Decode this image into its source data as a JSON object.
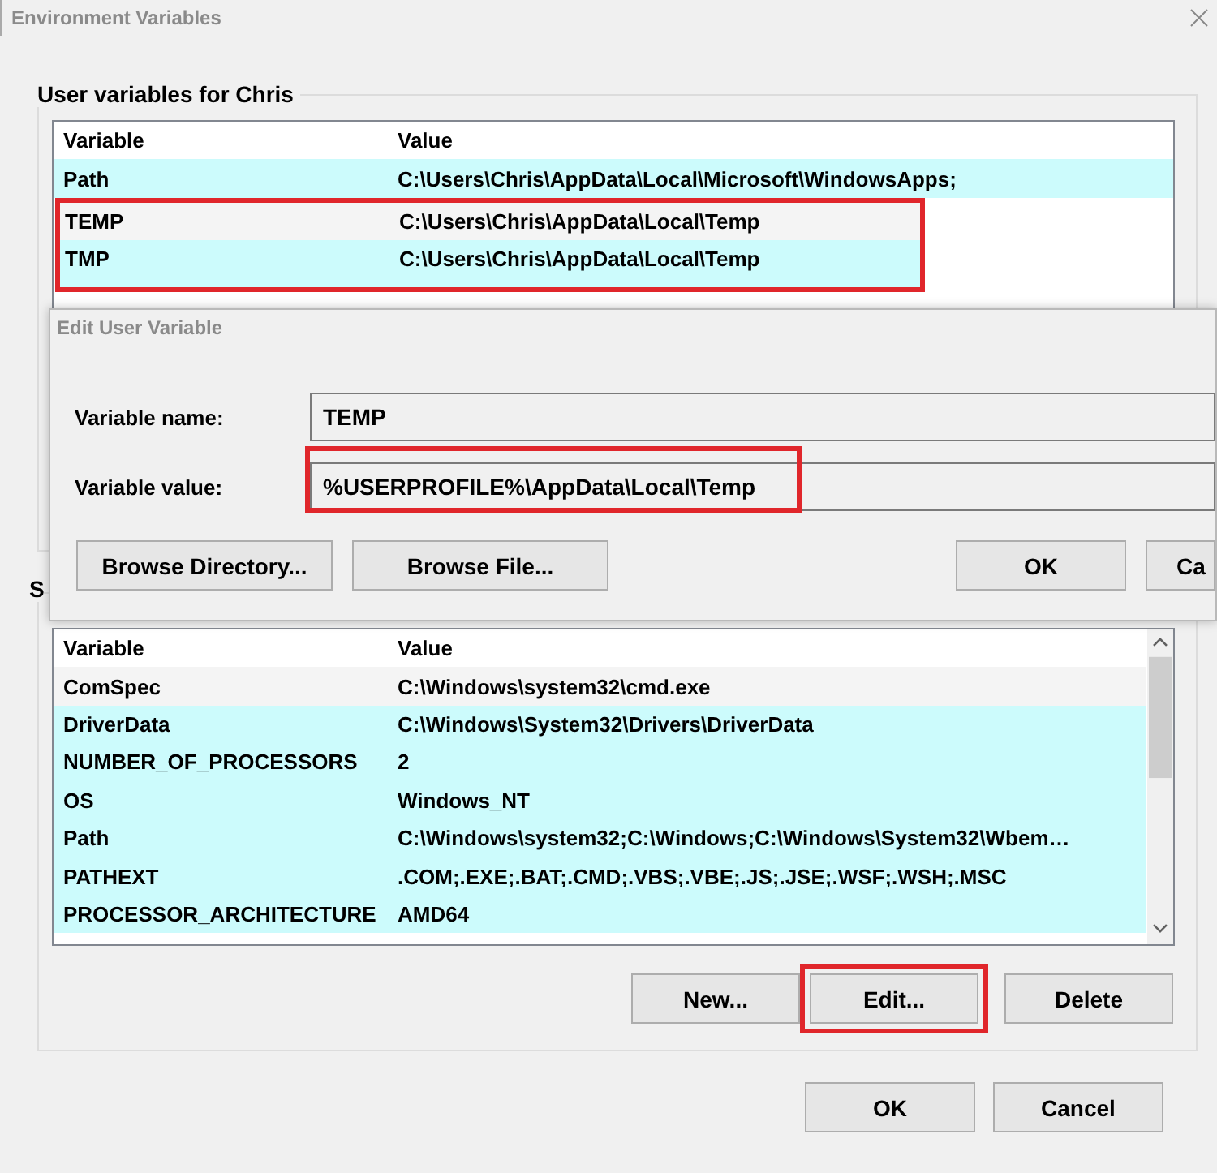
{
  "window": {
    "title": "Environment Variables"
  },
  "user_variables": {
    "label": "User variables for Chris",
    "columns": [
      "Variable",
      "Value"
    ],
    "rows": [
      {
        "variable": "Path",
        "value": "C:\\Users\\Chris\\AppData\\Local\\Microsoft\\WindowsApps;",
        "selected": false,
        "highlighted": false
      },
      {
        "variable": "TEMP",
        "value": "C:\\Users\\Chris\\AppData\\Local\\Temp",
        "selected": true,
        "highlighted": true
      },
      {
        "variable": "TMP",
        "value": "C:\\Users\\Chris\\AppData\\Local\\Temp",
        "selected": false,
        "highlighted": true
      }
    ]
  },
  "edit_dialog": {
    "title": "Edit User Variable",
    "fields": [
      {
        "label": "Variable name:",
        "value": "TEMP",
        "highlighted": false
      },
      {
        "label": "Variable value:",
        "value": "%USERPROFILE%\\AppData\\Local\\Temp",
        "highlighted": true
      }
    ],
    "buttons": [
      {
        "label": "Browse Directory...",
        "kind": "left"
      },
      {
        "label": "Browse File...",
        "kind": "left"
      },
      {
        "label": "OK",
        "kind": "right"
      },
      {
        "label": "Ca",
        "kind": "right"
      }
    ]
  },
  "system_variables": {
    "label": "S",
    "columns": [
      "Variable",
      "Value"
    ],
    "rows": [
      {
        "variable": "ComSpec",
        "value": "C:\\Windows\\system32\\cmd.exe",
        "selected": true
      },
      {
        "variable": "DriverData",
        "value": "C:\\Windows\\System32\\Drivers\\DriverData",
        "selected": false
      },
      {
        "variable": "NUMBER_OF_PROCESSORS",
        "value": "2",
        "selected": false
      },
      {
        "variable": "OS",
        "value": "Windows_NT",
        "selected": false
      },
      {
        "variable": "Path",
        "value": "C:\\Windows\\system32;C:\\Windows;C:\\Windows\\System32\\Wbem…",
        "selected": false
      },
      {
        "variable": "PATHEXT",
        "value": ".COM;.EXE;.BAT;.CMD;.VBS;.VBE;.JS;.JSE;.WSF;.WSH;.MSC",
        "selected": false
      },
      {
        "variable": "PROCESSOR_ARCHITECTURE",
        "value": "AMD64",
        "selected": false
      }
    ],
    "buttons": [
      {
        "label": "New...",
        "highlighted": false
      },
      {
        "label": "Edit...",
        "highlighted": true
      },
      {
        "label": "Delete",
        "highlighted": false
      }
    ]
  },
  "buttons": [
    {
      "label": "OK"
    },
    {
      "label": "Cancel"
    }
  ]
}
